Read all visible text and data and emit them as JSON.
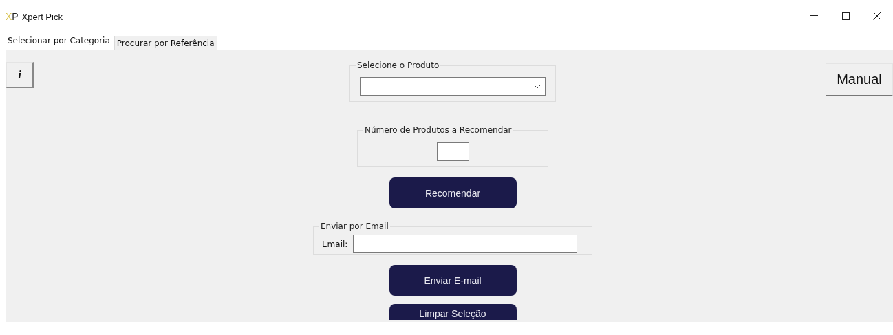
{
  "window": {
    "logo": "XP",
    "title": "Xpert Pick"
  },
  "tabs": [
    {
      "label": "Selecionar por Categoria",
      "selected": true
    },
    {
      "label": "Procurar por Referência",
      "selected": false
    }
  ],
  "info_button": {
    "label": "i"
  },
  "manual_button": {
    "label": "Manual"
  },
  "product_group": {
    "title": "Selecione o Produto"
  },
  "count_group": {
    "title": "Número de Produtos a Recomendar"
  },
  "recommend_button": {
    "label": "Recomendar"
  },
  "email_group": {
    "title": "Enviar por Email",
    "field_label": "Email:"
  },
  "send_button": {
    "label": "Enviar E-mail"
  },
  "clear_button": {
    "label": "Limpar Seleção"
  }
}
